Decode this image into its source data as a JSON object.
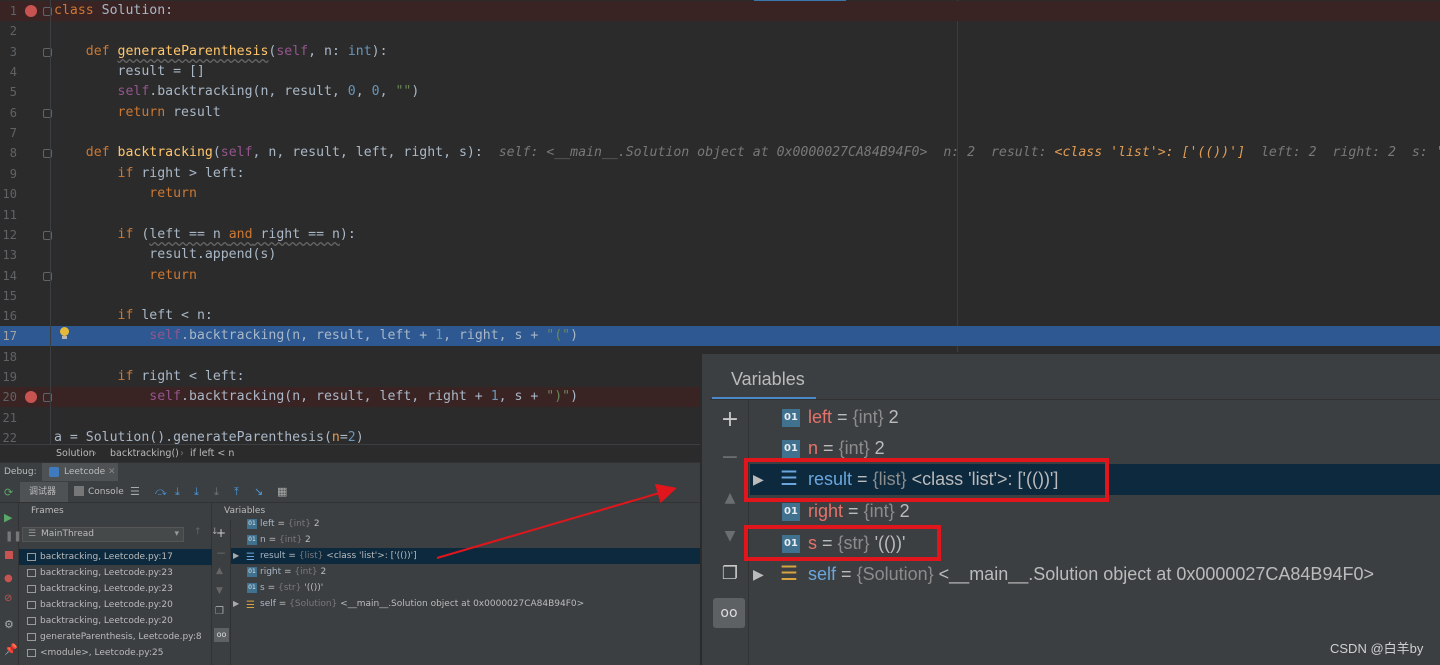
{
  "editor": {
    "lines": [
      {
        "n": "1",
        "text": "class Solution:"
      },
      {
        "n": "2",
        "text": ""
      },
      {
        "n": "3",
        "text": "    def generateParenthesis(self, n: int):"
      },
      {
        "n": "4",
        "text": "        result = []"
      },
      {
        "n": "5",
        "text": "        self.backtracking(n, result, 0, 0, \"\")"
      },
      {
        "n": "6",
        "text": "        return result"
      },
      {
        "n": "7",
        "text": ""
      },
      {
        "n": "8",
        "text": "    def backtracking(self, n, result, left, right, s):"
      },
      {
        "n": "9",
        "text": "        if right > left:"
      },
      {
        "n": "10",
        "text": "            return"
      },
      {
        "n": "11",
        "text": ""
      },
      {
        "n": "12",
        "text": "        if (left == n and right == n):"
      },
      {
        "n": "13",
        "text": "            result.append(s)"
      },
      {
        "n": "14",
        "text": "            return"
      },
      {
        "n": "15",
        "text": ""
      },
      {
        "n": "16",
        "text": "        if left < n:"
      },
      {
        "n": "17",
        "text": "            self.backtracking(n, result, left + 1, right, s + \"(\")"
      },
      {
        "n": "18",
        "text": ""
      },
      {
        "n": "19",
        "text": "        if right < left:"
      },
      {
        "n": "20",
        "text": "            self.backtracking(n, result, left, right + 1, s + \")\")"
      },
      {
        "n": "21",
        "text": ""
      },
      {
        "n": "22",
        "text": "a = Solution().generateParenthesis(n=2)"
      }
    ],
    "inline_self": "self: <__main__.Solution object at 0x0000027CA84B94F0>",
    "inline_n": "n: 2",
    "inline_result_label": "result:",
    "inline_result_value": "<class 'list'>: ['(())']",
    "inline_left": "left: 2",
    "inline_right": "right: 2",
    "inline_s": "s: '(())'"
  },
  "breadcrumb": {
    "items": [
      "Solution",
      "backtracking()",
      "if left < n"
    ]
  },
  "debug": {
    "label": "Debug:",
    "tab": "Leetcode",
    "tab_debugger": "调试器",
    "tab_console": "Console",
    "frames_header": "Frames",
    "variables_header": "Variables",
    "thread": "MainThread",
    "frames": [
      "backtracking, Leetcode.py:17",
      "backtracking, Leetcode.py:23",
      "backtracking, Leetcode.py:23",
      "backtracking, Leetcode.py:20",
      "backtracking, Leetcode.py:20",
      "generateParenthesis, Leetcode.py:8",
      "<module>, Leetcode.py:25"
    ],
    "variables": [
      {
        "name": "left",
        "type": "{int}",
        "value": "2",
        "icon": "01"
      },
      {
        "name": "n",
        "type": "{int}",
        "value": "2",
        "icon": "01"
      },
      {
        "name": "result",
        "type": "{list}",
        "value": "<class 'list'>: ['(())']",
        "icon": "list"
      },
      {
        "name": "right",
        "type": "{int}",
        "value": "2",
        "icon": "01"
      },
      {
        "name": "s",
        "type": "{str}",
        "value": "'(())'",
        "icon": "01"
      },
      {
        "name": "self",
        "type": "{Solution}",
        "value": "<__main__.Solution object at 0x0000027CA84B94F0>",
        "icon": "obj"
      }
    ]
  },
  "zoom": {
    "title": "Variables",
    "eq": "=",
    "rows": [
      {
        "name": "left",
        "type": "{int}",
        "value": "2"
      },
      {
        "name": "n",
        "type": "{int}",
        "value": "2"
      },
      {
        "name": "result",
        "type": "{list}",
        "value": "<class 'list'>: ['(())']"
      },
      {
        "name": "right",
        "type": "{int}",
        "value": "2"
      },
      {
        "name": "s",
        "type": "{str}",
        "value": "'(())'"
      },
      {
        "name": "self",
        "type": "{Solution}",
        "value": "<__main__.Solution object at 0x0000027CA84B94F0>"
      }
    ]
  },
  "watermark": "CSDN @白羊by",
  "colors": {
    "breakpoint": "#c75450",
    "execution_line": "#2d5891",
    "highlight_box": "#e0161c",
    "annotation_arrow": "#e0161c"
  }
}
